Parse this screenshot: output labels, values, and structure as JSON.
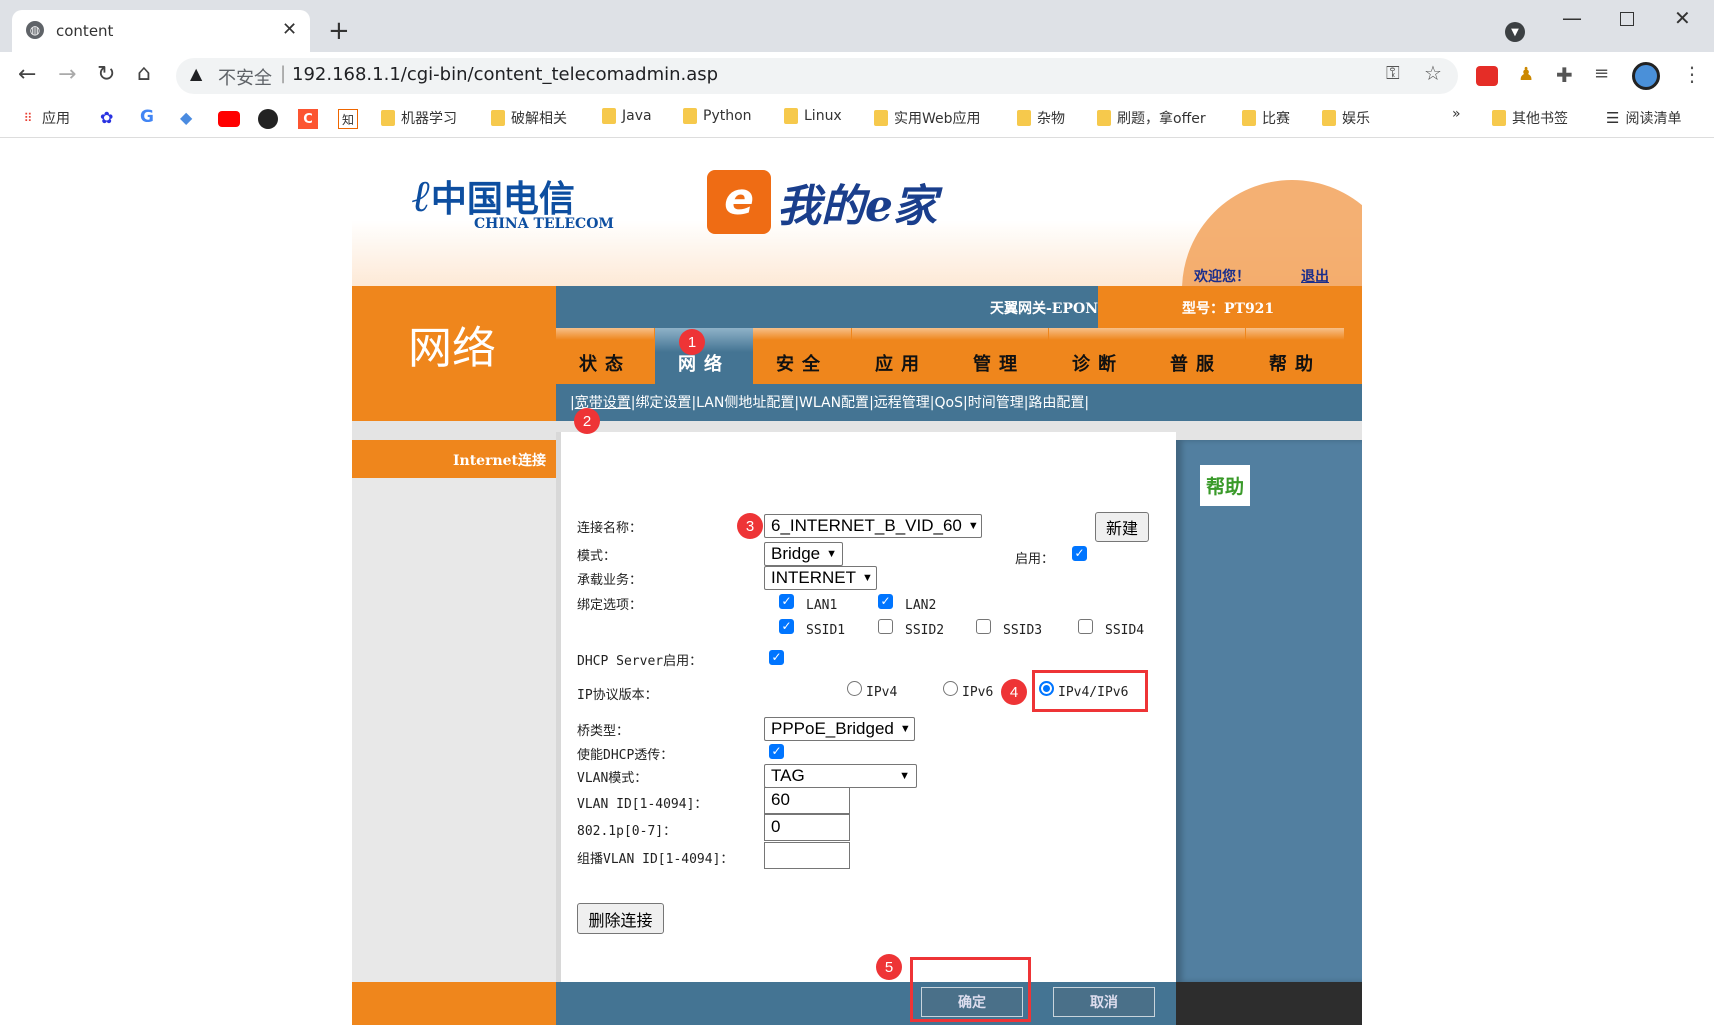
{
  "browser": {
    "tab_title": "content",
    "security_label": "不安全",
    "url": "192.168.1.1/cgi-bin/content_telecomadmin.asp",
    "bookmarks": [
      {
        "label": "应用",
        "icon": "apps-icon"
      },
      {
        "label": "机器学习"
      },
      {
        "label": "破解相关"
      },
      {
        "label": "Java"
      },
      {
        "label": "Python"
      },
      {
        "label": "Linux"
      },
      {
        "label": "实用Web应用"
      },
      {
        "label": "杂物"
      },
      {
        "label": "刷题，拿offer"
      },
      {
        "label": "比赛"
      },
      {
        "label": "娱乐"
      }
    ],
    "more_bookmarks": "»",
    "other_bookmarks": "其他书签",
    "reading_list": "阅读清单"
  },
  "header": {
    "logo_text": "中国电信 CHINA TELECOM",
    "brand_text": "我的e家",
    "welcome": "欢迎您！",
    "logout": "退出",
    "gateway": "天翼网关-EPON",
    "model": "型号：PT921",
    "section_title": "网络"
  },
  "nav": {
    "items": [
      "状态",
      "网络",
      "安全",
      "应用",
      "管理",
      "诊断",
      "普服",
      "帮助"
    ],
    "active": "网络",
    "sub": [
      "宽带设置",
      "绑定设置",
      "LAN侧地址配置",
      "WLAN配置",
      "远程管理",
      "QoS",
      "时间管理",
      "路由配置"
    ]
  },
  "sidebar": {
    "item": "Internet连接"
  },
  "form": {
    "conn_name_label": "连接名称：",
    "conn_name_value": "6_INTERNET_B_VID_60",
    "new_button": "新建",
    "mode_label": "模式：",
    "mode_value": "Bridge",
    "enable_label": "启用：",
    "enable_checked": true,
    "service_label": "承载业务：",
    "service_value": "INTERNET",
    "bind_label": "绑定选项：",
    "bind_options": [
      {
        "label": "LAN1",
        "checked": true
      },
      {
        "label": "LAN2",
        "checked": true
      },
      {
        "label": "SSID1",
        "checked": true
      },
      {
        "label": "SSID2",
        "checked": false
      },
      {
        "label": "SSID3",
        "checked": false
      },
      {
        "label": "SSID4",
        "checked": false
      }
    ],
    "dhcp_label": "DHCP Server启用：",
    "dhcp_checked": true,
    "ip_label": "IP协议版本：",
    "ip_options": [
      "IPv4",
      "IPv6",
      "IPv4/IPv6"
    ],
    "ip_selected": "IPv4/IPv6",
    "bridge_label": "桥类型：",
    "bridge_value": "PPPoE_Bridged",
    "dhcp_pass_label": "使能DHCP透传：",
    "dhcp_pass_checked": true,
    "vlan_mode_label": "VLAN模式：",
    "vlan_mode_value": "TAG",
    "vlan_id_label": "VLAN ID[1-4094]：",
    "vlan_id_value": "60",
    "p8021_label": "802.1p[0-7]：",
    "p8021_value": "0",
    "mcast_label": "组播VLAN ID[1-4094]：",
    "mcast_value": "",
    "delete_button": "删除连接"
  },
  "help": {
    "title": "帮助"
  },
  "footer": {
    "ok": "确定",
    "cancel": "取消"
  },
  "annotations": [
    "1",
    "2",
    "3",
    "4",
    "5"
  ],
  "colors": {
    "orange": "#ef861c",
    "blue": "#447493",
    "marker": "#ee3436",
    "help_green": "#3a9a2a"
  }
}
